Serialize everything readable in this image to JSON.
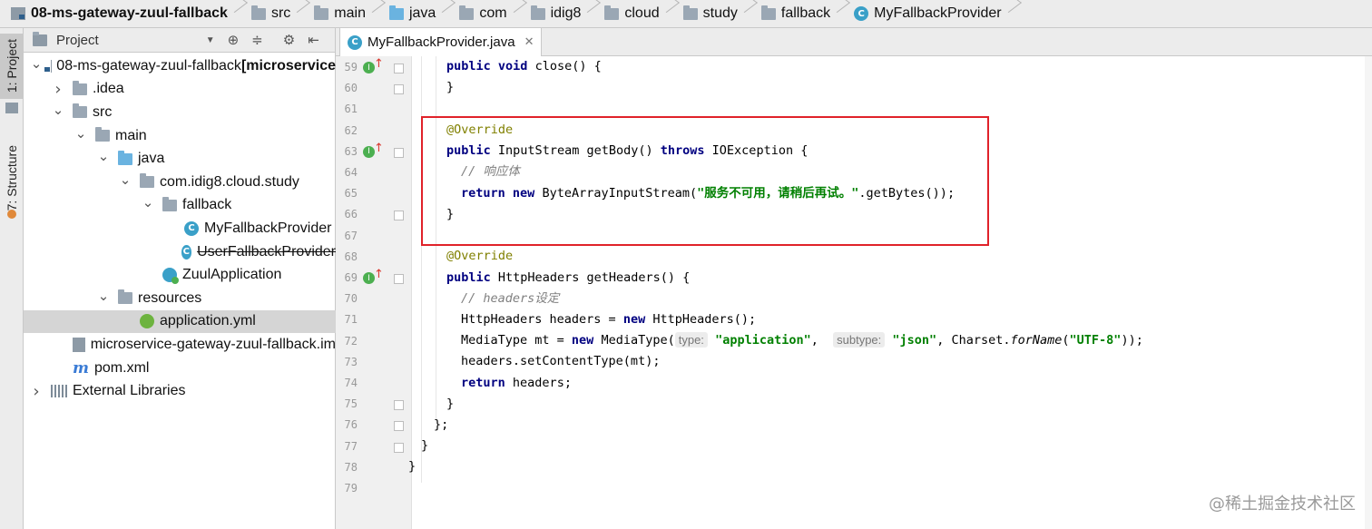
{
  "breadcrumb": {
    "items": [
      {
        "label": "08-ms-gateway-zuul-fallback",
        "icon": "project-icon"
      },
      {
        "label": "src",
        "icon": "folder-icon"
      },
      {
        "label": "main",
        "icon": "folder-icon"
      },
      {
        "label": "java",
        "icon": "source-folder-icon"
      },
      {
        "label": "com",
        "icon": "package-icon"
      },
      {
        "label": "idig8",
        "icon": "package-icon"
      },
      {
        "label": "cloud",
        "icon": "package-icon"
      },
      {
        "label": "study",
        "icon": "package-icon"
      },
      {
        "label": "fallback",
        "icon": "package-icon"
      },
      {
        "label": "MyFallbackProvider",
        "icon": "class-icon"
      }
    ]
  },
  "toolstrip": {
    "project_tab": "1: Project",
    "structure_tab": "7: Structure"
  },
  "project_panel": {
    "title": "Project",
    "tree": [
      {
        "label": "08-ms-gateway-zuul-fallback [microservice",
        "suffix": "",
        "icon": "module-icon",
        "arrow": "expanded"
      },
      {
        "label": ".idea",
        "icon": "folder-icon",
        "arrow": "collapsed"
      },
      {
        "label": "src",
        "icon": "folder-icon",
        "arrow": "expanded"
      },
      {
        "label": "main",
        "icon": "folder-icon",
        "arrow": "expanded"
      },
      {
        "label": "java",
        "icon": "source-folder-icon",
        "arrow": "expanded"
      },
      {
        "label": "com.idig8.cloud.study",
        "icon": "package-icon",
        "arrow": "expanded"
      },
      {
        "label": "fallback",
        "icon": "package-icon",
        "arrow": "expanded"
      },
      {
        "label": "MyFallbackProvider",
        "icon": "class-icon",
        "arrow": "none"
      },
      {
        "label": "UserFallbackProvider",
        "icon": "class-icon",
        "arrow": "none",
        "strike": true
      },
      {
        "label": "ZuulApplication",
        "icon": "spring-app-icon",
        "arrow": "none"
      },
      {
        "label": "resources",
        "icon": "resources-folder-icon",
        "arrow": "expanded"
      },
      {
        "label": "application.yml",
        "icon": "spring-yml-icon",
        "arrow": "none",
        "selected": true
      },
      {
        "label": "microservice-gateway-zuul-fallback.im",
        "icon": "iml-file-icon",
        "arrow": "none"
      },
      {
        "label": "pom.xml",
        "icon": "maven-icon",
        "arrow": "none"
      },
      {
        "label": "External Libraries",
        "icon": "libraries-icon",
        "arrow": "collapsed"
      }
    ]
  },
  "editor": {
    "tab_label": "MyFallbackProvider.java",
    "line_numbers": [
      "59",
      "60",
      "61",
      "62",
      "63",
      "64",
      "65",
      "66",
      "67",
      "68",
      "69",
      "70",
      "71",
      "72",
      "73",
      "74",
      "75",
      "76",
      "77",
      "78",
      "79"
    ],
    "code": {
      "l59": {
        "kw1": "public",
        "kw2": "void",
        "rest": "close() {"
      },
      "l60": {
        "text": "}"
      },
      "l62": {
        "ann": "@Override"
      },
      "l63": {
        "kw1": "public",
        "type": "InputStream getBody()",
        "kw2": "throws",
        "rest": "IOException {"
      },
      "l64": {
        "comment": "// 响应体"
      },
      "l65": {
        "kw1": "return",
        "kw2": "new",
        "pre": "ByteArrayInputStream(",
        "str": "\"服务不可用，请稍后再试。\"",
        "post": ".getBytes());"
      },
      "l66": {
        "text": "}"
      },
      "l68": {
        "ann": "@Override"
      },
      "l69": {
        "kw1": "public",
        "rest": "HttpHeaders getHeaders() {"
      },
      "l70": {
        "comment": "// headers设定"
      },
      "l71": {
        "pre": "HttpHeaders headers = ",
        "kw1": "new",
        "post": "HttpHeaders();"
      },
      "l72": {
        "pre": "MediaType mt = ",
        "kw1": "new",
        "mid": "MediaType(",
        "hint1": "type:",
        "str1": "\"application\"",
        "hint2": "subtype:",
        "str2": "\"json\"",
        "mid2": ", Charset.",
        "fn": "forName",
        "open": "(",
        "str3": "\"UTF-8\"",
        "post": "));"
      },
      "l73": {
        "text": "headers.setContentType(mt);"
      },
      "l74": {
        "kw1": "return",
        "rest": "headers;"
      },
      "l75": {
        "text": "}"
      },
      "l76": {
        "text": "};"
      },
      "l77": {
        "text": "}"
      },
      "l78": {
        "text": "}"
      }
    }
  },
  "watermark": "@稀土掘金技术社区",
  "colors": {
    "keyword": "#000080",
    "annotation": "#808000",
    "string": "#008000",
    "comment": "#808080",
    "highlight_box": "#e0222a"
  }
}
